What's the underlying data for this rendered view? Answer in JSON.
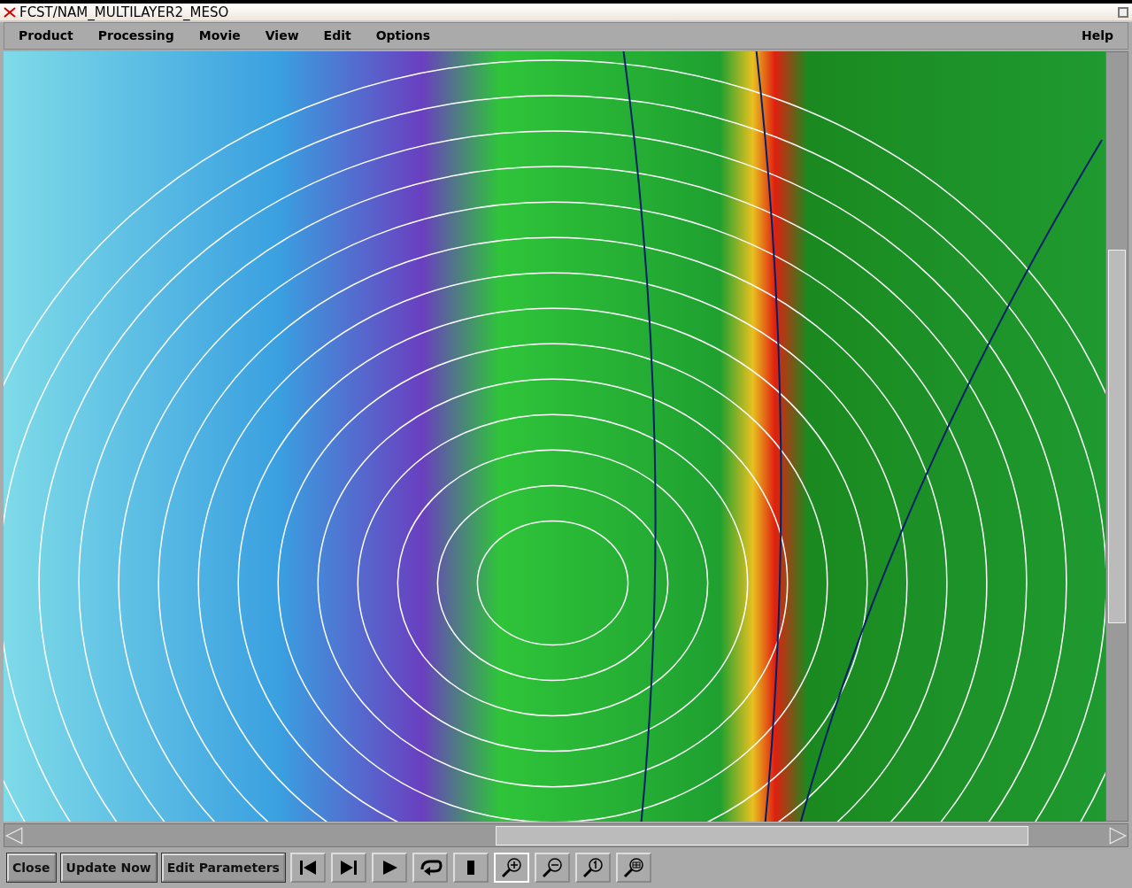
{
  "window": {
    "title": "FCST/NAM_MULTILAYER2_MESO"
  },
  "menu": [
    "Product",
    "Processing",
    "Movie",
    "View",
    "Edit",
    "Options"
  ],
  "help_menu": "Help",
  "buttons": [
    "Close",
    "Update Now",
    "Edit Parameters"
  ],
  "tools": [
    {
      "kind": "first",
      "selected": false
    },
    {
      "kind": "last",
      "selected": false
    },
    {
      "kind": "play",
      "selected": false
    },
    {
      "kind": "loop",
      "selected": false
    },
    {
      "kind": "stop",
      "selected": false
    },
    {
      "kind": "zoom-in",
      "selected": true
    },
    {
      "kind": "zoom-out",
      "selected": false
    },
    {
      "kind": "zoom-one",
      "selected": false
    },
    {
      "kind": "zoom-grid",
      "selected": false
    }
  ]
}
